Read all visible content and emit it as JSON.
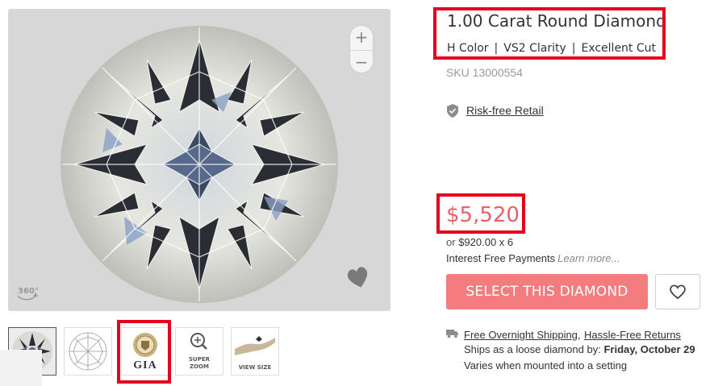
{
  "viewer": {
    "zoom_in": "+",
    "zoom_out": "−",
    "spin_label": "360°"
  },
  "thumbnails": [
    {
      "name": "diamond-photo",
      "caption": ""
    },
    {
      "name": "diamond-diagram",
      "caption": ""
    },
    {
      "name": "gia-certificate",
      "caption": "GIA"
    },
    {
      "name": "super-zoom",
      "caption": "SUPER ZOOM"
    },
    {
      "name": "view-size",
      "caption": "VIEW SIZE"
    }
  ],
  "product": {
    "title": "1.00 Carat Round Diamond",
    "color": "H Color",
    "clarity": "VS2 Clarity",
    "cut": "Excellent Cut",
    "sep": "|",
    "sku": "SKU 13000554"
  },
  "risk": {
    "label": "Risk-free Retail"
  },
  "pricing": {
    "price": "$5,520",
    "or": "or",
    "monthly_amount": "$920.00 x 6",
    "interest_text": "Interest Free Payments",
    "learn_more": "Learn more..."
  },
  "actions": {
    "select_label": "SELECT THIS DIAMOND"
  },
  "shipping": {
    "overnight": "Free Overnight Shipping",
    "comma": ",",
    "returns": "Hassle-Free Returns",
    "ships_as_prefix": "Ships as a loose diamond by:",
    "ship_date": "Friday, October 29",
    "varies": "Varies when mounted into a setting"
  },
  "colors": {
    "accent": "#f47c7f",
    "price": "#e8606a",
    "highlight": "#e5001b",
    "viewer_bg": "#d7d7d7"
  },
  "icons": {
    "shield": "shield-check-icon",
    "truck": "truck-icon",
    "heart": "heart-icon",
    "spin": "rotate-360-icon",
    "zoom": "magnifier-plus-icon",
    "hand": "hand-ring-icon"
  }
}
